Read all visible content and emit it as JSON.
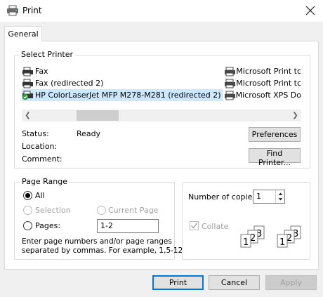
{
  "window": {
    "title": "Print"
  },
  "tabs": [
    {
      "label": "General"
    }
  ],
  "select_printer": {
    "legend": "Select Printer",
    "printers_col1": [
      {
        "name": "Fax",
        "icon": "fax-icon"
      },
      {
        "name": "Fax (redirected 2)",
        "icon": "fax-icon"
      },
      {
        "name": "HP ColorLaserJet MFP M278-M281 (redirected 2)",
        "icon": "printer-default-icon",
        "selected": true
      }
    ],
    "printers_col2": [
      {
        "name": "Microsoft Print tc",
        "icon": "printer-icon"
      },
      {
        "name": "Microsoft Print tc",
        "icon": "printer-icon"
      },
      {
        "name": "Microsoft XPS Do",
        "icon": "printer-icon"
      }
    ],
    "status_label": "Status:",
    "status_value": "Ready",
    "location_label": "Location:",
    "location_value": "",
    "comment_label": "Comment:",
    "comment_value": "",
    "preferences_button": "Preferences",
    "find_printer_button": "Find Printer..."
  },
  "page_range": {
    "legend": "Page Range",
    "all_label": "All",
    "selection_label": "Selection",
    "current_page_label": "Current Page",
    "pages_label": "Pages:",
    "pages_value": "1-2",
    "hint_line1": "Enter page numbers and/or page ranges",
    "hint_line2": "separated by commas.  For example, 1,5-12"
  },
  "copies": {
    "label": "Number of copies:",
    "value": "1",
    "collate_label": "Collate",
    "collate_checked": true
  },
  "buttons": {
    "print": "Print",
    "cancel": "Cancel",
    "apply": "Apply"
  }
}
